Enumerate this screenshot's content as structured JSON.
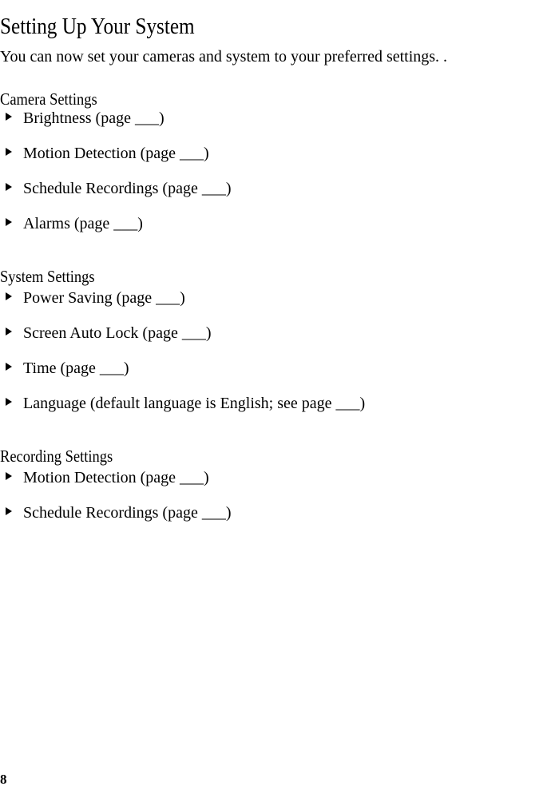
{
  "document": {
    "title": "Setting Up Your System",
    "intro": "You can now set your cameras and system to your preferred settings. .",
    "page_number": "8",
    "sections": [
      {
        "heading": "Camera Settings",
        "items": [
          "Brightness (page ___)",
          "Motion Detection (page ___)",
          "Schedule Recordings (page ___)",
          "Alarms (page ___)"
        ]
      },
      {
        "heading": "System Settings",
        "items": [
          "Power Saving (page ___)",
          "Screen Auto Lock (page ___)",
          "Time (page ___)",
          "Language (default language is English; see page ___)"
        ]
      },
      {
        "heading": "Recording Settings",
        "items": [
          "Motion Detection (page ___)",
          "Schedule Recordings (page ___)"
        ]
      }
    ]
  }
}
